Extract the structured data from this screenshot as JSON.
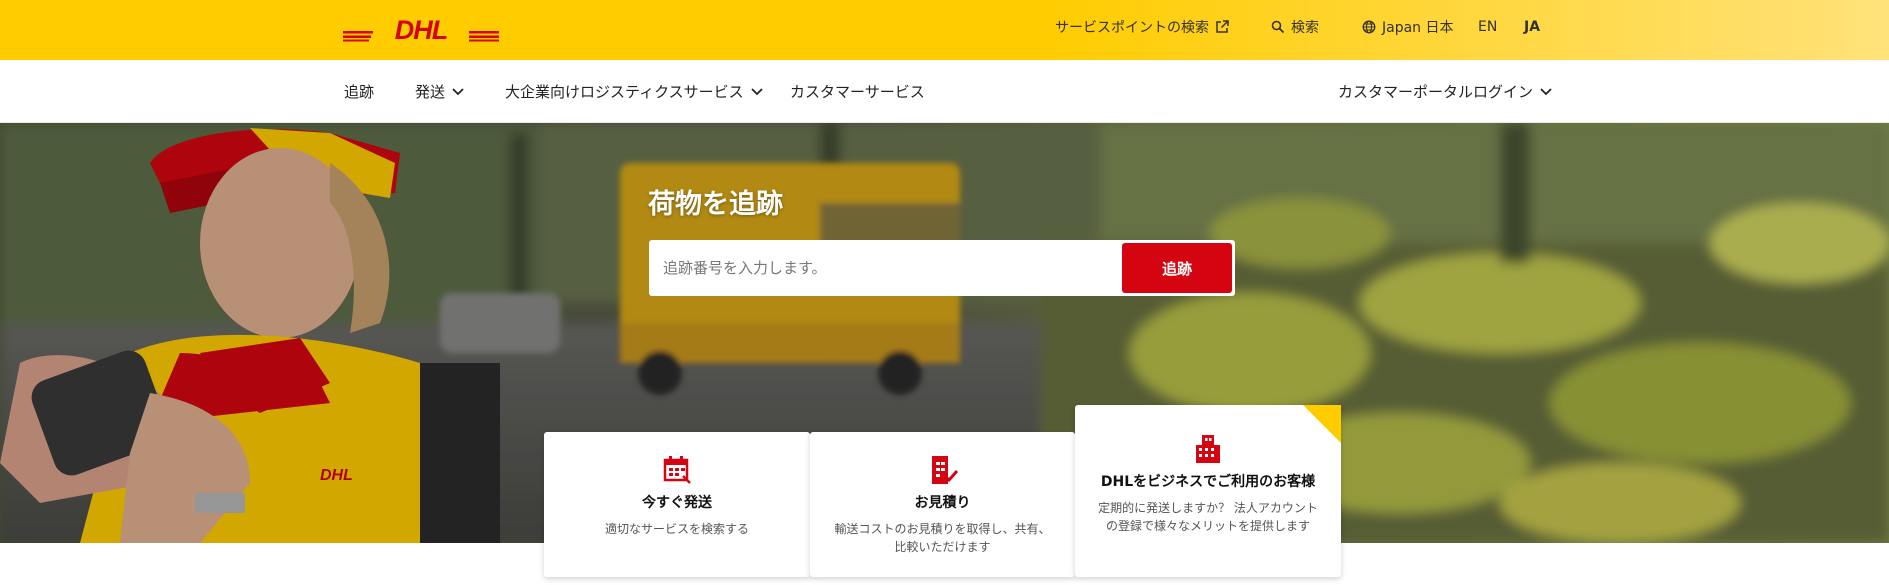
{
  "brand": {
    "logo_text": "DHL",
    "logo_icon": "dhl-logo",
    "accent_yellow": "#ffcc00",
    "accent_red": "#d40511"
  },
  "topbar": {
    "service_point": "サービスポイントの検索",
    "search": "検索",
    "region": "Japan 日本",
    "lang_en": "EN",
    "lang_ja": "JA"
  },
  "nav": {
    "tracking": "追跡",
    "shipping": "発送",
    "enterprise": "大企業向けロジスティクスサービス",
    "customer_service": "カスタマーサービス",
    "portal_login": "カスタマーポータルログイン"
  },
  "hero": {
    "title": "荷物を追跡",
    "input_placeholder": "追跡番号を入力します。",
    "input_value": "",
    "button": "追跡"
  },
  "cards": [
    {
      "icon": "calendar-box-icon",
      "title": "今すぐ発送",
      "desc": "適切なサービスを検索する"
    },
    {
      "icon": "quote-document-icon",
      "title": "お見積り",
      "desc": "輸送コストのお見積りを取得し、共有、比較いただけます"
    },
    {
      "icon": "building-icon",
      "title": "DHLをビジネスでご利用のお客様",
      "desc": "定期的に発送しますか？ 法人アカウントの登録で様々なメリットを提供します"
    }
  ]
}
